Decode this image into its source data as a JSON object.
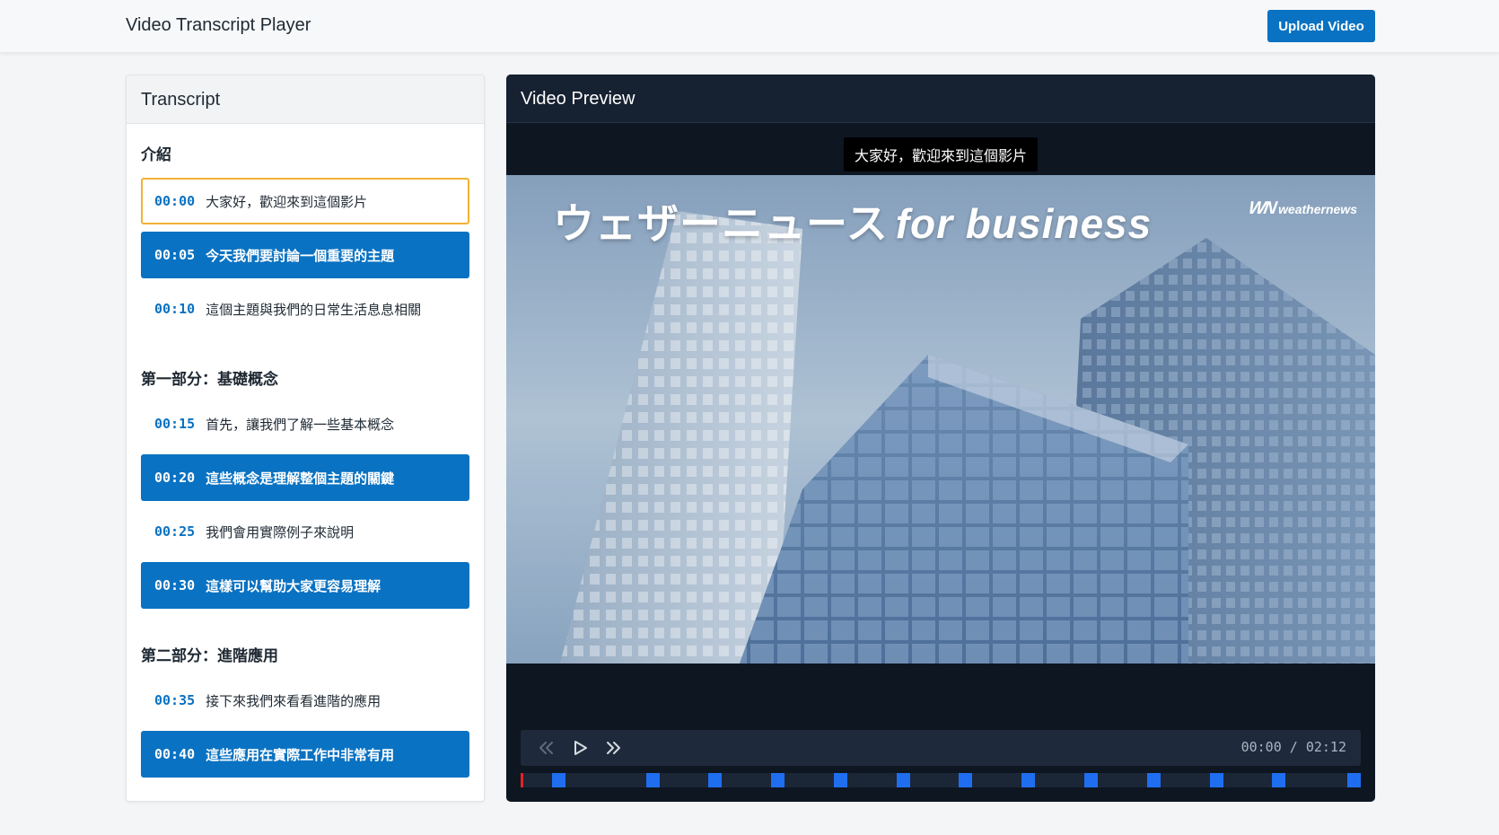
{
  "app": {
    "title": "Video Transcript Player",
    "upload_label": "Upload Video"
  },
  "transcript": {
    "header": "Transcript",
    "sections": [
      {
        "title": "介紹",
        "lines": [
          {
            "time": "00:00",
            "text": "大家好，歡迎來到這個影片",
            "state": "current"
          },
          {
            "time": "00:05",
            "text": "今天我們要討論一個重要的主題",
            "state": "highlighted"
          },
          {
            "time": "00:10",
            "text": "這個主題與我們的日常生活息息相關",
            "state": "normal"
          }
        ]
      },
      {
        "title": "第一部分：基礎概念",
        "lines": [
          {
            "time": "00:15",
            "text": "首先，讓我們了解一些基本概念",
            "state": "normal"
          },
          {
            "time": "00:20",
            "text": "這些概念是理解整個主題的關鍵",
            "state": "highlighted"
          },
          {
            "time": "00:25",
            "text": "我們會用實際例子來說明",
            "state": "normal"
          },
          {
            "time": "00:30",
            "text": "這樣可以幫助大家更容易理解",
            "state": "highlighted"
          }
        ]
      },
      {
        "title": "第二部分：進階應用",
        "lines": [
          {
            "time": "00:35",
            "text": "接下來我們來看看進階的應用",
            "state": "normal"
          },
          {
            "time": "00:40",
            "text": "這些應用在實際工作中非常有用",
            "state": "highlighted"
          }
        ]
      }
    ]
  },
  "video": {
    "header": "Video Preview",
    "subtitle": "大家好，歡迎來到這個影片",
    "frame_title_jp": "ウェザーニュース",
    "frame_title_en": "for business",
    "brand_mark": "WN",
    "brand_name": "weathernews",
    "current_time": "00:00",
    "duration": "02:12",
    "time_display": "00:00 / 02:12",
    "progress_fraction": 0.0,
    "marker_times_seconds": [
      5,
      20,
      30,
      40,
      50,
      60,
      70,
      80,
      90,
      100,
      110,
      120,
      132
    ],
    "colors": {
      "accent": "#0a72c2",
      "marker": "#1f6ef0",
      "played": "#e02424",
      "current_outline": "#f2b233"
    },
    "icons": [
      "skip-back-icon",
      "play-icon",
      "skip-forward-icon"
    ]
  }
}
